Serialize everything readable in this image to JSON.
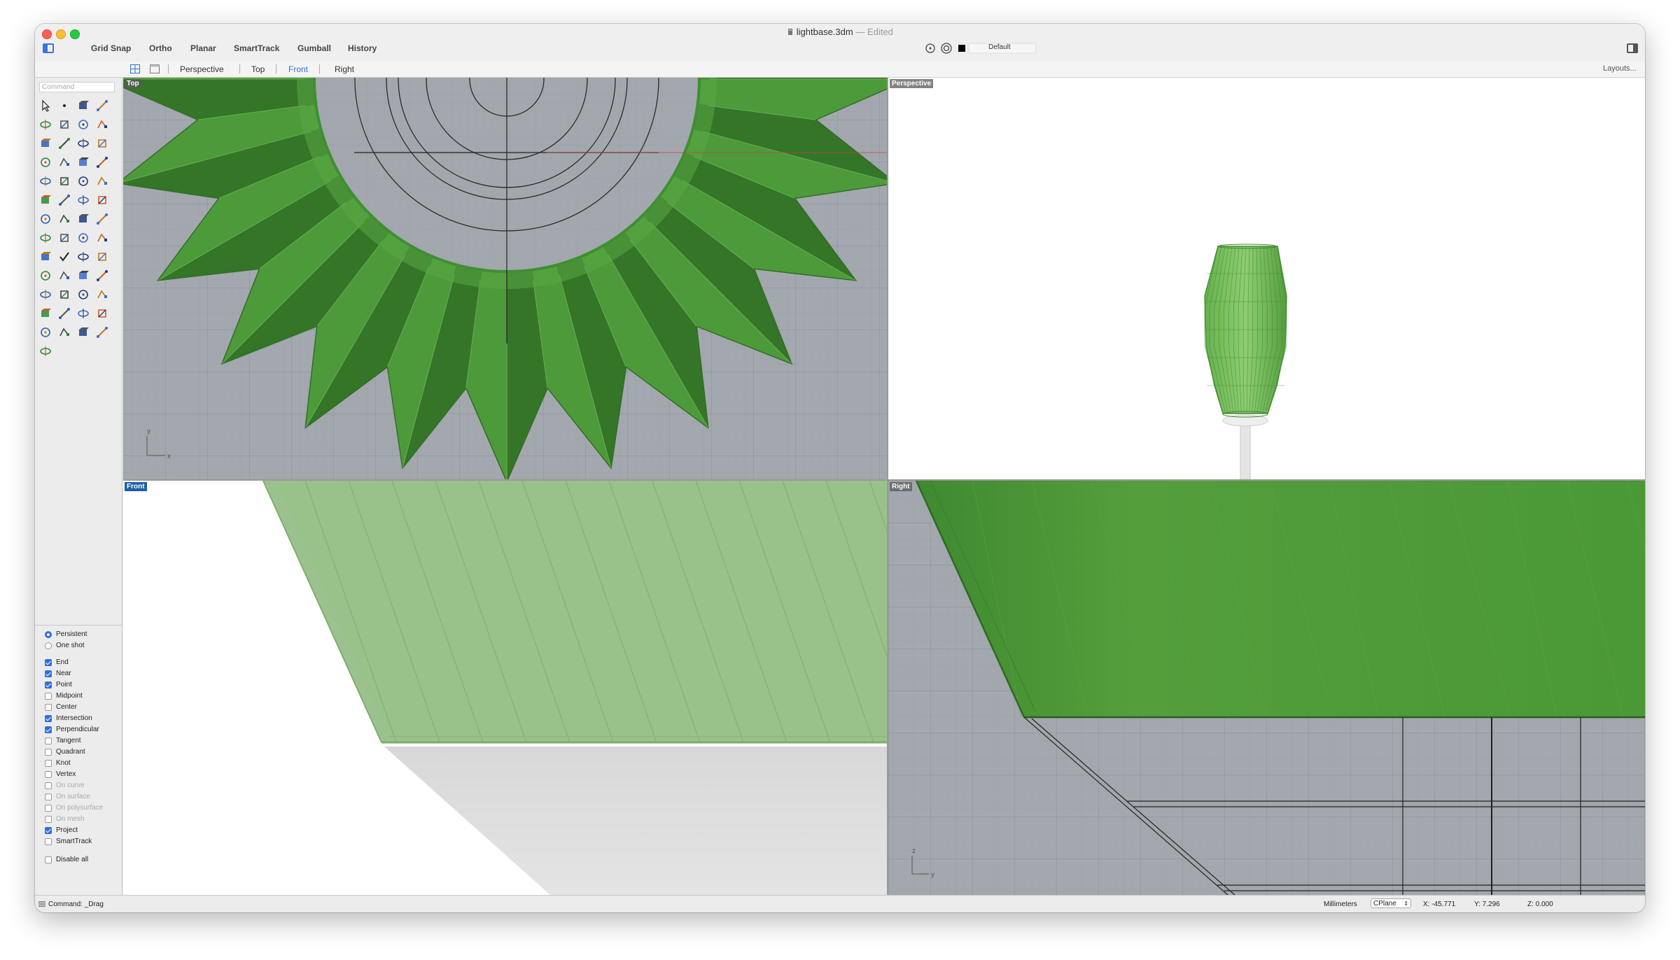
{
  "window": {
    "title": "lightbase.3dm",
    "title_sep": "—",
    "title_status": "Edited"
  },
  "toolbar": {
    "grid_snap": "Grid Snap",
    "ortho": "Ortho",
    "planar": "Planar",
    "smarttrack": "SmartTrack",
    "gumball": "Gumball",
    "history": "History",
    "layer": "Default"
  },
  "tabs": {
    "perspective": "Perspective",
    "top": "Top",
    "front": "Front",
    "right": "Right",
    "active": "Front",
    "layouts": "Layouts..."
  },
  "command_placeholder": "Command",
  "osnap": {
    "persistent": "Persistent",
    "one_shot": "One shot",
    "items": [
      {
        "label": "End",
        "checked": true,
        "enabled": true
      },
      {
        "label": "Near",
        "checked": true,
        "enabled": true
      },
      {
        "label": "Point",
        "checked": true,
        "enabled": true
      },
      {
        "label": "Midpoint",
        "checked": false,
        "enabled": true
      },
      {
        "label": "Center",
        "checked": false,
        "enabled": true
      },
      {
        "label": "Intersection",
        "checked": true,
        "enabled": true
      },
      {
        "label": "Perpendicular",
        "checked": true,
        "enabled": true
      },
      {
        "label": "Tangent",
        "checked": false,
        "enabled": true
      },
      {
        "label": "Quadrant",
        "checked": false,
        "enabled": true
      },
      {
        "label": "Knot",
        "checked": false,
        "enabled": true
      },
      {
        "label": "Vertex",
        "checked": false,
        "enabled": true
      },
      {
        "label": "On curve",
        "checked": false,
        "enabled": false
      },
      {
        "label": "On surface",
        "checked": false,
        "enabled": false
      },
      {
        "label": "On polysurface",
        "checked": false,
        "enabled": false
      },
      {
        "label": "On mesh",
        "checked": false,
        "enabled": false
      },
      {
        "label": "Project",
        "checked": true,
        "enabled": true
      },
      {
        "label": "SmartTrack",
        "checked": false,
        "enabled": true
      }
    ],
    "disable_all": "Disable all"
  },
  "viewports": {
    "top": "Top",
    "perspective": "Perspective",
    "front": "Front",
    "right": "Right",
    "axis_y": "y",
    "axis_x": "x",
    "axis_z": "z"
  },
  "status": {
    "command": "Command: _Drag",
    "units": "Millimeters",
    "cplane": "CPlane",
    "x": "X: -45.771",
    "y": "Y: 7.296",
    "z": "Z: 0.000"
  },
  "colors": {
    "accent": "#2f6fdc",
    "model_green": "#4f9a3b",
    "viewport_gray": "#a3a7ae",
    "active_label": "#1e5fa8"
  },
  "tool_icons": [
    "select-icon",
    "point-icon",
    "polyline-icon",
    "curve-icon",
    "circle-icon",
    "ellipse-icon",
    "polygon-icon",
    "rectangle-icon",
    "arc-icon",
    "fillet-icon",
    "transform-icon",
    "surface-icon",
    "box-icon",
    "sphere-icon",
    "cylinder-icon",
    "extrude-icon",
    "solid-tools-icon",
    "boolean-icon",
    "cap-icon",
    "trim-icon",
    "mesh-icon",
    "split-icon",
    "join-icon",
    "explode-icon",
    "move-icon",
    "scale-icon",
    "array-icon",
    "mirror-icon",
    "group-icon",
    "dimension-icon",
    "grid-icon",
    "text-icon",
    "layer-icon",
    "check-icon",
    "analyze-icon",
    "properties-icon",
    "zoom-icon",
    "zoom-window-icon",
    "zoom-extents-icon",
    "zoom-selected-icon",
    "rotate-view-icon",
    "car-icon",
    "lens-icon",
    "light-icon",
    "lightbulb-icon",
    "lock-icon",
    "material-icon",
    "environment-icon",
    "render-icon",
    "camera-icon",
    "sphere-render-icon",
    "spotlight-icon",
    "cplane-icon"
  ]
}
